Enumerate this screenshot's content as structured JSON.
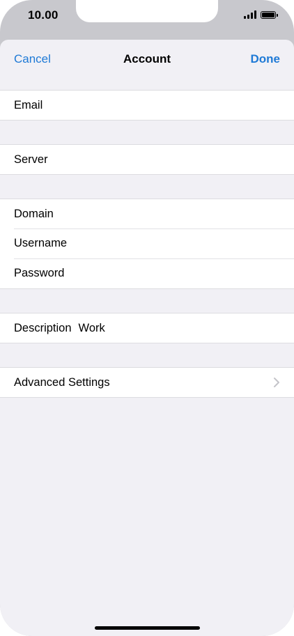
{
  "status_bar": {
    "time": "10.00"
  },
  "navbar": {
    "cancel_label": "Cancel",
    "title": "Account",
    "done_label": "Done"
  },
  "groups": {
    "email": {
      "label": "Email"
    },
    "server": {
      "label": "Server"
    },
    "credentials": {
      "domain_label": "Domain",
      "username_label": "Username",
      "password_label": "Password"
    },
    "description": {
      "label": "Description",
      "value": "Work"
    },
    "advanced": {
      "label": "Advanced Settings"
    }
  },
  "colors": {
    "accent": "#1f7ad6",
    "background": "#f1f0f5",
    "cell": "#ffffff",
    "separator": "#dcdce0"
  },
  "icons": {
    "signal": "cellular-signal-icon",
    "battery": "battery-icon",
    "chevron": "chevron-right-icon"
  }
}
